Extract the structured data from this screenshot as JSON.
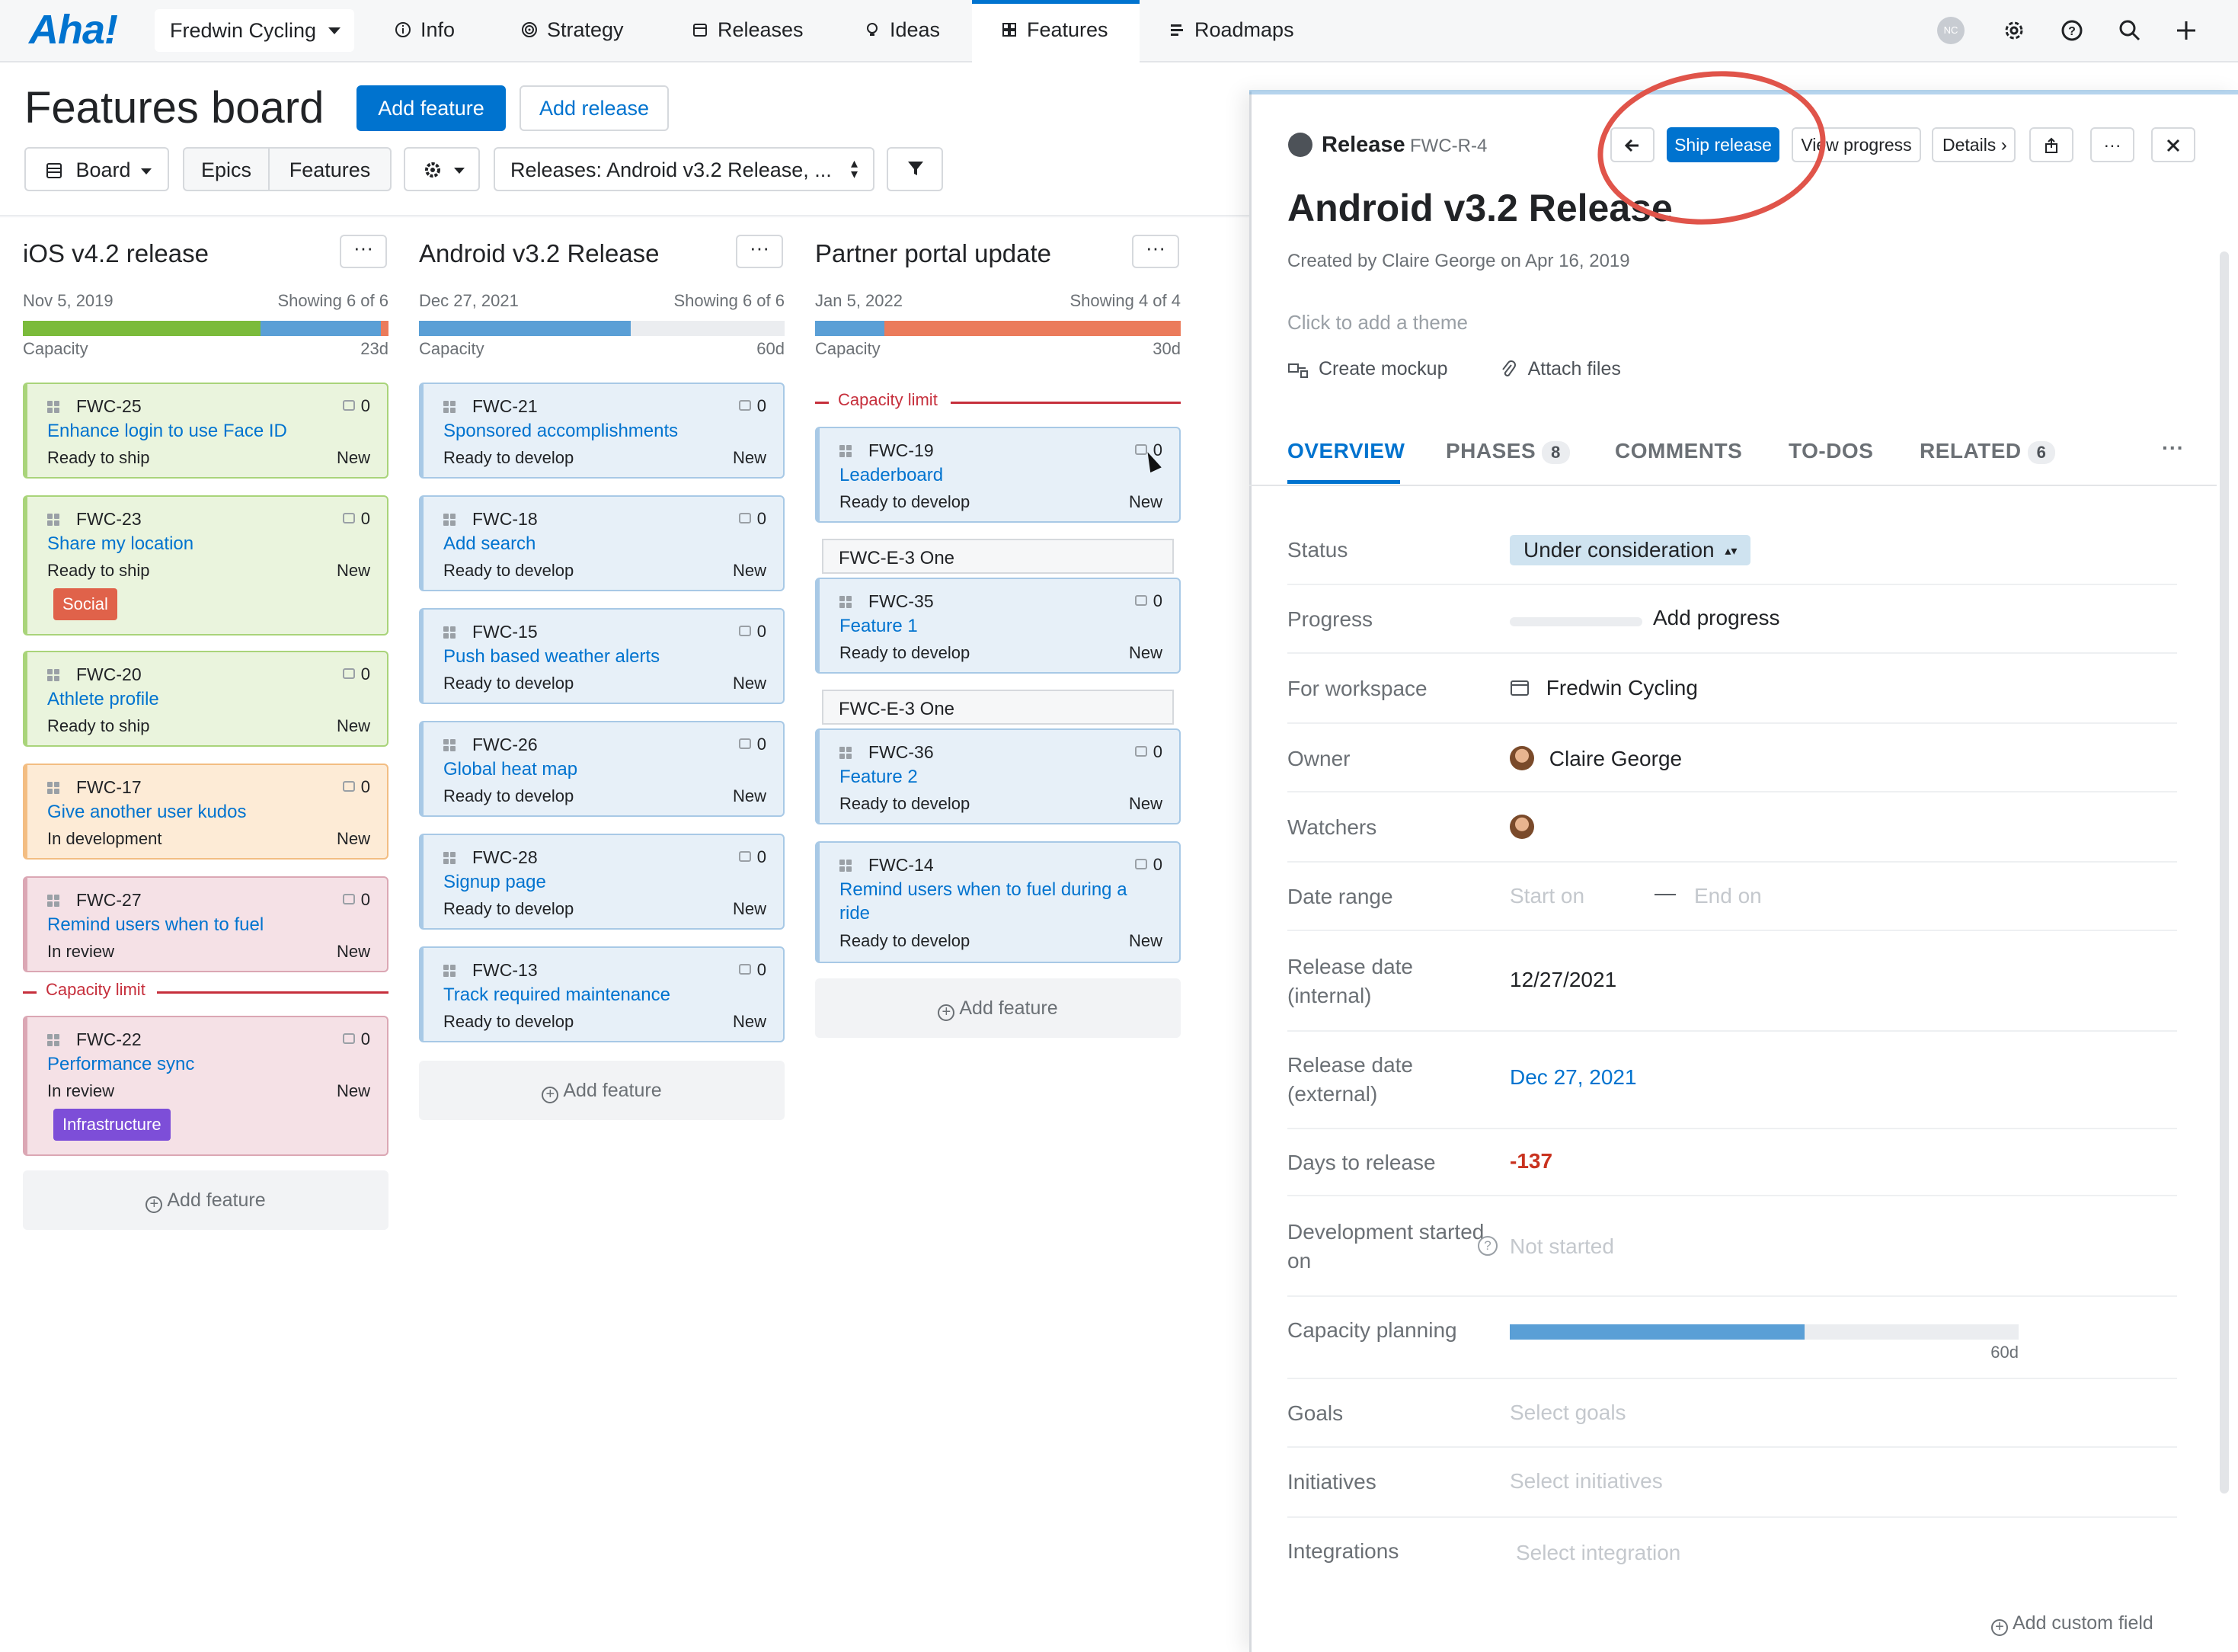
{
  "nav": {
    "logo": "Aha!",
    "workspace": "Fredwin Cycling",
    "tabs": [
      "Info",
      "Strategy",
      "Releases",
      "Ideas",
      "Features",
      "Roadmaps"
    ],
    "active_tab": "Features",
    "avatar_initials": "NC"
  },
  "header": {
    "title": "Features board",
    "add_feature": "Add feature",
    "add_release": "Add release",
    "view_select": "Board",
    "seg_epics": "Epics",
    "seg_features": "Features",
    "releases_filter": "Releases: Android v3.2 Release, ..."
  },
  "board": {
    "columns": [
      {
        "title": "iOS v4.2 release",
        "date": "Nov 5, 2019",
        "showing": "Showing 6 of 6",
        "capacity_label": "Capacity",
        "capacity_value": "23d",
        "capacity_limit": "Capacity limit",
        "add_feature": "Add feature",
        "cards": [
          {
            "id": "FWC-25",
            "name": "Enhance login to use Face ID",
            "status": "Ready to ship",
            "state": "New",
            "count": "0"
          },
          {
            "id": "FWC-23",
            "name": "Share my location",
            "status": "Ready to ship",
            "state": "New",
            "count": "0",
            "tag": "Social"
          },
          {
            "id": "FWC-20",
            "name": "Athlete profile",
            "status": "Ready to ship",
            "state": "New",
            "count": "0"
          },
          {
            "id": "FWC-17",
            "name": "Give another user kudos",
            "status": "In development",
            "state": "New",
            "count": "0"
          },
          {
            "id": "FWC-27",
            "name": "Remind users when to fuel",
            "status": "In review",
            "state": "New",
            "count": "0"
          },
          {
            "id": "FWC-22",
            "name": "Performance sync",
            "status": "In review",
            "state": "New",
            "count": "0",
            "tag": "Infrastructure"
          }
        ]
      },
      {
        "title": "Android v3.2 Release",
        "date": "Dec 27, 2021",
        "showing": "Showing 6 of 6",
        "capacity_label": "Capacity",
        "capacity_value": "60d",
        "add_feature": "Add feature",
        "cards": [
          {
            "id": "FWC-21",
            "name": "Sponsored accomplishments",
            "status": "Ready to develop",
            "state": "New",
            "count": "0"
          },
          {
            "id": "FWC-18",
            "name": "Add search",
            "status": "Ready to develop",
            "state": "New",
            "count": "0"
          },
          {
            "id": "FWC-15",
            "name": "Push based weather alerts",
            "status": "Ready to develop",
            "state": "New",
            "count": "0"
          },
          {
            "id": "FWC-26",
            "name": "Global heat map",
            "status": "Ready to develop",
            "state": "New",
            "count": "0"
          },
          {
            "id": "FWC-28",
            "name": "Signup page",
            "status": "Ready to develop",
            "state": "New",
            "count": "0"
          },
          {
            "id": "FWC-13",
            "name": "Track required maintenance",
            "status": "Ready to develop",
            "state": "New",
            "count": "0"
          }
        ]
      },
      {
        "title": "Partner portal update",
        "date": "Jan 5, 2022",
        "showing": "Showing 4 of 4",
        "capacity_label": "Capacity",
        "capacity_value": "30d",
        "capacity_limit": "Capacity limit",
        "add_feature": "Add feature",
        "epic_label": "FWC-E-3 One",
        "cards": [
          {
            "id": "FWC-19",
            "name": "Leaderboard",
            "status": "Ready to develop",
            "state": "New",
            "count": "0"
          },
          {
            "id": "FWC-35",
            "name": "Feature 1",
            "status": "Ready to develop",
            "state": "New",
            "count": "0"
          },
          {
            "id": "FWC-36",
            "name": "Feature 2",
            "status": "Ready to develop",
            "state": "New",
            "count": "0"
          },
          {
            "id": "FWC-14",
            "name": "Remind users when to fuel during a ride",
            "status": "Ready to develop",
            "state": "New",
            "count": "0"
          }
        ]
      }
    ]
  },
  "detail": {
    "type": "Release",
    "ref": "FWC-R-4",
    "ship_release": "Ship release",
    "view_progress": "View progress",
    "details": "Details",
    "title": "Android v3.2 Release",
    "created": "Created by Claire George on Apr 16, 2019",
    "theme_placeholder": "Click to add a theme",
    "create_mockup": "Create mockup",
    "attach_files": "Attach files",
    "tabs": {
      "overview": "OVERVIEW",
      "phases": "PHASES",
      "phases_count": "8",
      "comments": "COMMENTS",
      "todos": "TO-DOS",
      "related": "RELATED",
      "related_count": "6"
    },
    "fields": {
      "status_label": "Status",
      "status_value": "Under consideration",
      "progress_label": "Progress",
      "progress_value": "Add progress",
      "workspace_label": "For workspace",
      "workspace_value": "Fredwin Cycling",
      "owner_label": "Owner",
      "owner_value": "Claire George",
      "watchers_label": "Watchers",
      "date_range_label": "Date range",
      "start_on": "Start on",
      "end_on": "End on",
      "release_internal_label": "Release date (internal)",
      "release_internal_value": "12/27/2021",
      "release_external_label": "Release date (external)",
      "release_external_value": "Dec 27, 2021",
      "days_label": "Days to release",
      "days_value": "-137",
      "dev_started_label": "Development started on",
      "dev_started_value": "Not started",
      "capacity_label": "Capacity planning",
      "capacity_value": "60d",
      "capacity_fill": 0.58,
      "goals_label": "Goals",
      "goals_placeholder": "Select goals",
      "initiatives_label": "Initiatives",
      "initiatives_placeholder": "Select initiatives",
      "integrations_label": "Integrations",
      "integrations_placeholder": "Select integration",
      "add_custom_field": "Add custom field"
    }
  },
  "colors": {
    "brand": "#0073cf",
    "capacity_blue": "#5a9fd6",
    "capacity_green": "#7bbb3b",
    "capacity_orange": "#eb7b5b",
    "danger": "#c62f3c",
    "annotation": "#e0544a"
  }
}
